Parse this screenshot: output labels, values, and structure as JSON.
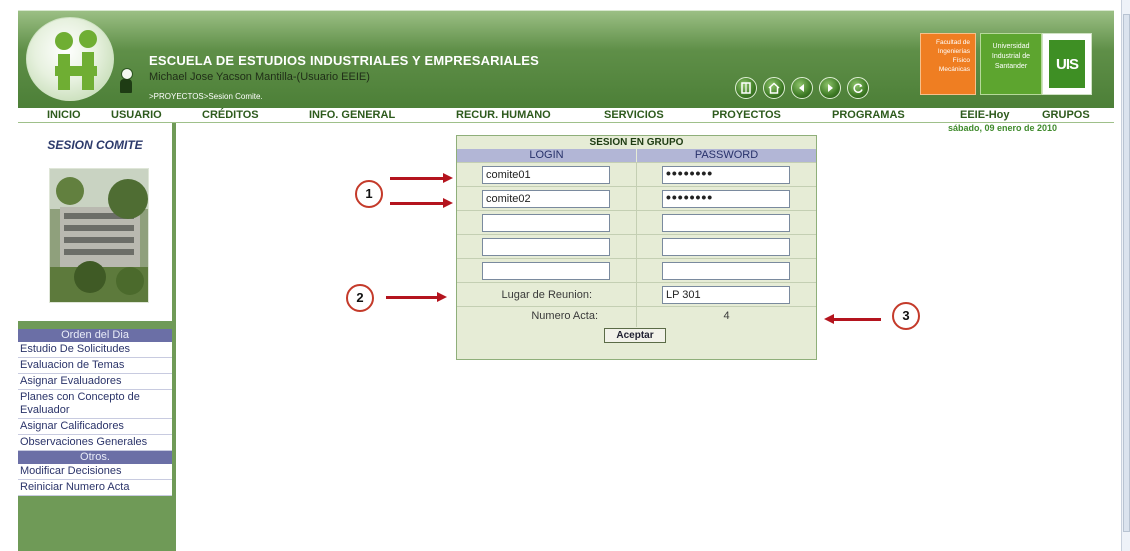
{
  "header": {
    "school_title": "ESCUELA DE ESTUDIOS INDUSTRIALES Y EMPRESARIALES",
    "user_name": "Michael Jose Yacson Mantilla-(Usuario EEIE)",
    "breadcrumb": ">PROYECTOS>Sesion Comite.",
    "facultad_label": "Facultad de Ingenierías Físico Mecánicas",
    "univ_label": "Universidad Industrial de Santander",
    "uis_logo_text": "UIS",
    "icons": [
      "door-icon",
      "home-icon",
      "back-icon",
      "forward-icon",
      "refresh-icon"
    ]
  },
  "nav": {
    "items": [
      "INICIO",
      "USUARIO",
      "CRÉDITOS",
      "INFO. GENERAL",
      "RECUR. HUMANO",
      "SERVICIOS",
      "PROYECTOS",
      "PROGRAMAS",
      "EEIE-Hoy",
      "GRUPOS"
    ],
    "date": "sábado, 09 enero de 2010"
  },
  "sidebar": {
    "title": "SESION COMITE",
    "menu_head": "Orden del Dia",
    "items": [
      "Estudio De Solicitudes",
      "Evaluacion de Temas",
      "Asignar Evaluadores",
      "Planes con Concepto de Evaluador",
      "Asignar Calificadores",
      "Observaciones Generales"
    ],
    "other_head": "Otros.",
    "other_items": [
      "Modificar Decisiones",
      "Reiniciar Numero Acta"
    ]
  },
  "form": {
    "title": "SESION EN GRUPO",
    "login_header": "LOGIN",
    "password_header": "PASSWORD",
    "rows": [
      {
        "login": "comite01",
        "password": "••••••••"
      },
      {
        "login": "comite02",
        "password": "••••••••"
      },
      {
        "login": "",
        "password": ""
      },
      {
        "login": "",
        "password": ""
      },
      {
        "login": "",
        "password": ""
      }
    ],
    "lugar_label": "Lugar de Reunion:",
    "lugar_value": "LP 301",
    "acta_label": "Numero Acta:",
    "acta_value": "4",
    "accept_label": "Aceptar"
  },
  "callouts": [
    "1",
    "2",
    "3"
  ],
  "colors": {
    "header_green": "#4c7f37",
    "nav_text": "#2d5a1c",
    "menu_head": "#6b6fa6",
    "callout_red": "#b4141e",
    "date_green": "#3f8a2c"
  }
}
